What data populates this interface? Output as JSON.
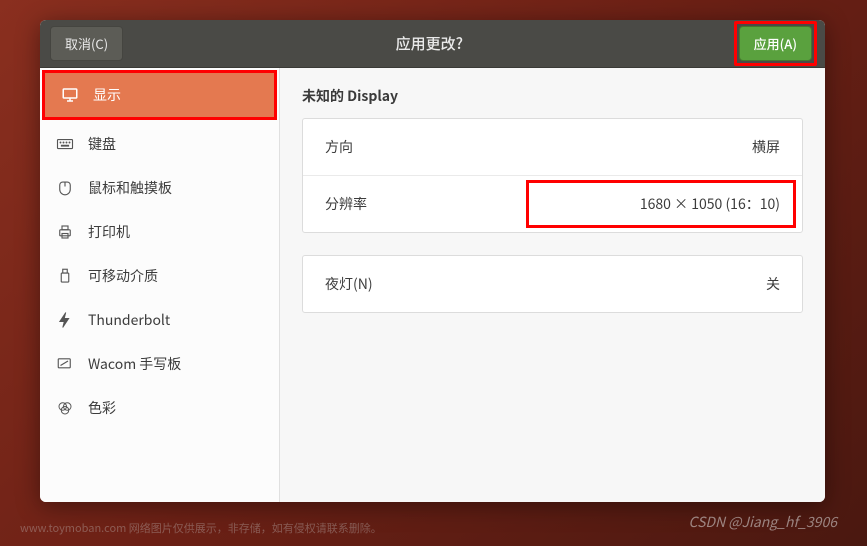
{
  "header": {
    "cancel_label": "取消(C)",
    "title": "应用更改?",
    "apply_label": "应用(A)"
  },
  "sidebar": {
    "items": [
      {
        "label": "显示"
      },
      {
        "label": "键盘"
      },
      {
        "label": "鼠标和触摸板"
      },
      {
        "label": "打印机"
      },
      {
        "label": "可移动介质"
      },
      {
        "label": "Thunderbolt"
      },
      {
        "label": "Wacom 手写板"
      },
      {
        "label": "色彩"
      }
    ]
  },
  "content": {
    "section_title": "未知的 Display",
    "orientation": {
      "label": "方向",
      "value": "横屏"
    },
    "resolution": {
      "label": "分辨率",
      "value": "1680 × 1050 (16：10)"
    },
    "nightlight": {
      "label": "夜灯(N)",
      "value": "关"
    }
  },
  "footer_note": "www.toymoban.com 网络图片仅供展示，非存储，如有侵权请联系删除。",
  "watermark": "CSDN @Jiang_hf_3906"
}
